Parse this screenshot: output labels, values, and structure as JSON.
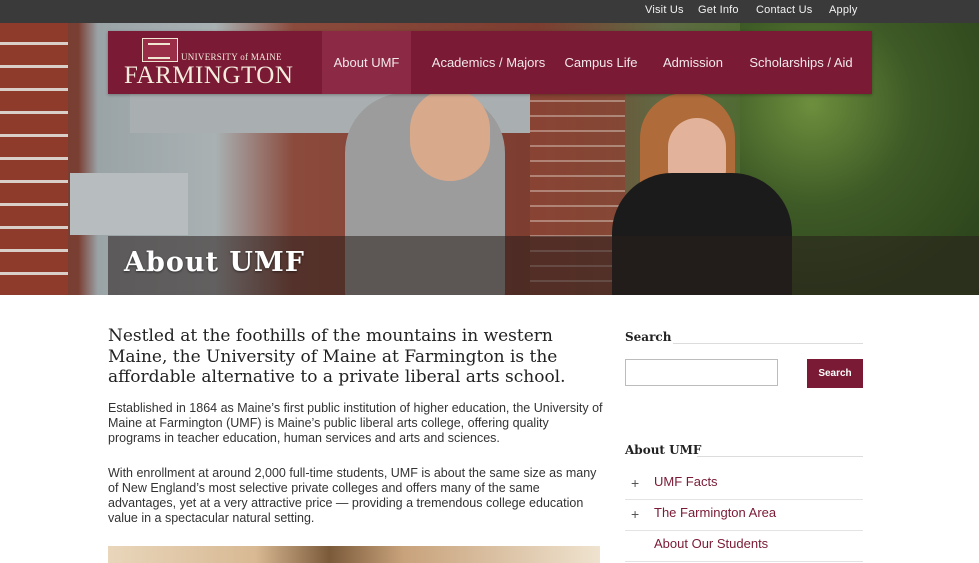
{
  "utility_nav": [
    "Visit Us",
    "Get Info",
    "Contact Us",
    "Apply"
  ],
  "logo": {
    "small_text": "UNIVERSITY of MAINE",
    "big_text": "FARMINGTON"
  },
  "main_nav": [
    {
      "label": "About UMF",
      "active": true
    },
    {
      "label": "Academics / Majors",
      "active": false
    },
    {
      "label": "Campus Life",
      "active": false
    },
    {
      "label": "Admission",
      "active": false
    },
    {
      "label": "Scholarships / Aid",
      "active": false
    }
  ],
  "hero": {
    "title": "About UMF"
  },
  "content": {
    "lead": "Nestled at the foothills of the mountains in western Maine, the University of Maine at Farmington is the affordable alternative to a private liberal arts school.",
    "paragraphs": [
      "Established in 1864 as Maine’s first public institution of higher education, the University of Maine at Farmington (UMF) is Maine’s public liberal arts college, offering quality programs in teacher education, human services and arts and sciences.",
      "With enrollment at around 2,000 full-time students, UMF is about the same size as many of New England’s most selective private colleges and offers many of the same advantages, yet at a very attractive price — providing a tremendous college education value in a spectacular natural setting."
    ]
  },
  "sidebar": {
    "search_heading": "Search",
    "search_value": "",
    "search_button": "Search",
    "section_heading": "About UMF",
    "items": [
      {
        "label": "UMF Facts",
        "expandable": "+"
      },
      {
        "label": "The Farmington Area",
        "expandable": "+"
      },
      {
        "label": "About Our Students",
        "expandable": ""
      }
    ]
  },
  "colors": {
    "brand": "#7a1a35",
    "utility_bar": "#3a3a3a"
  }
}
